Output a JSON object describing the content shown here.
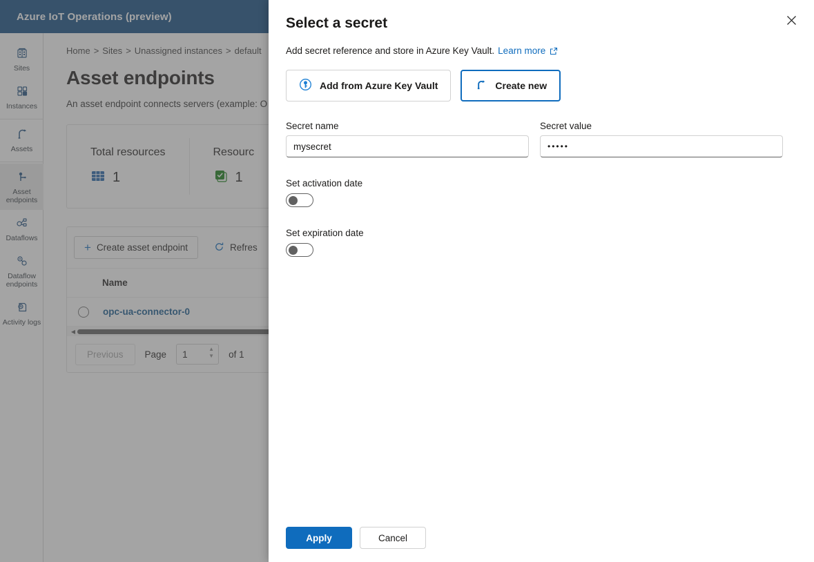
{
  "app": {
    "title": "Azure IoT Operations (preview)",
    "topbar_color": "#0f4b82"
  },
  "sidebar": {
    "items": [
      {
        "label": "Sites",
        "icon": "sites-icon",
        "active": false
      },
      {
        "label": "Instances",
        "icon": "instances-icon",
        "active": false
      },
      {
        "label": "Assets",
        "icon": "assets-icon",
        "active": false
      },
      {
        "label": "Asset endpoints",
        "icon": "asset-endpoints-icon",
        "active": true
      },
      {
        "label": "Dataflows",
        "icon": "dataflows-icon",
        "active": false
      },
      {
        "label": "Dataflow endpoints",
        "icon": "dataflow-endpoints-icon",
        "active": false
      },
      {
        "label": "Activity logs",
        "icon": "activity-logs-icon",
        "active": false
      }
    ]
  },
  "page": {
    "breadcrumb": [
      "Home",
      "Sites",
      "Unassigned instances",
      "default"
    ],
    "title": "Asset endpoints",
    "description": "An asset endpoint connects servers (example: O",
    "stats": [
      {
        "label": "Total resources",
        "value": "1",
        "icon": "grid-icon",
        "color": "#1b5fa8"
      },
      {
        "label": "Resourc",
        "value": "1",
        "icon": "success-icon",
        "color": "#107c10"
      }
    ],
    "toolbar": {
      "create_label": "Create asset endpoint",
      "refresh_label": "Refres"
    },
    "table": {
      "columns": [
        "Name"
      ],
      "rows": [
        {
          "name": "opc-ua-connector-0"
        }
      ]
    },
    "pagination": {
      "previous_label": "Previous",
      "page_label": "Page",
      "page_value": "1",
      "of_label": "of 1"
    }
  },
  "dialog": {
    "title": "Select a secret",
    "subtitle": "Add secret reference and store in Azure Key Vault.",
    "learn_more_label": "Learn more",
    "close_label": "Close",
    "modes": [
      {
        "label": "Add from Azure Key Vault",
        "icon": "key-vault-icon",
        "selected": false
      },
      {
        "label": "Create new",
        "icon": "create-new-icon",
        "selected": true
      }
    ],
    "fields": {
      "secret_name": {
        "label": "Secret name",
        "value": "mysecret",
        "placeholder": ""
      },
      "secret_value": {
        "label": "Secret value",
        "value": "•••••",
        "placeholder": ""
      }
    },
    "toggles": [
      {
        "label": "Set activation date",
        "on": false
      },
      {
        "label": "Set expiration date",
        "on": false
      }
    ],
    "footer": {
      "apply_label": "Apply",
      "cancel_label": "Cancel"
    },
    "accent_color": "#0f6cbd"
  }
}
